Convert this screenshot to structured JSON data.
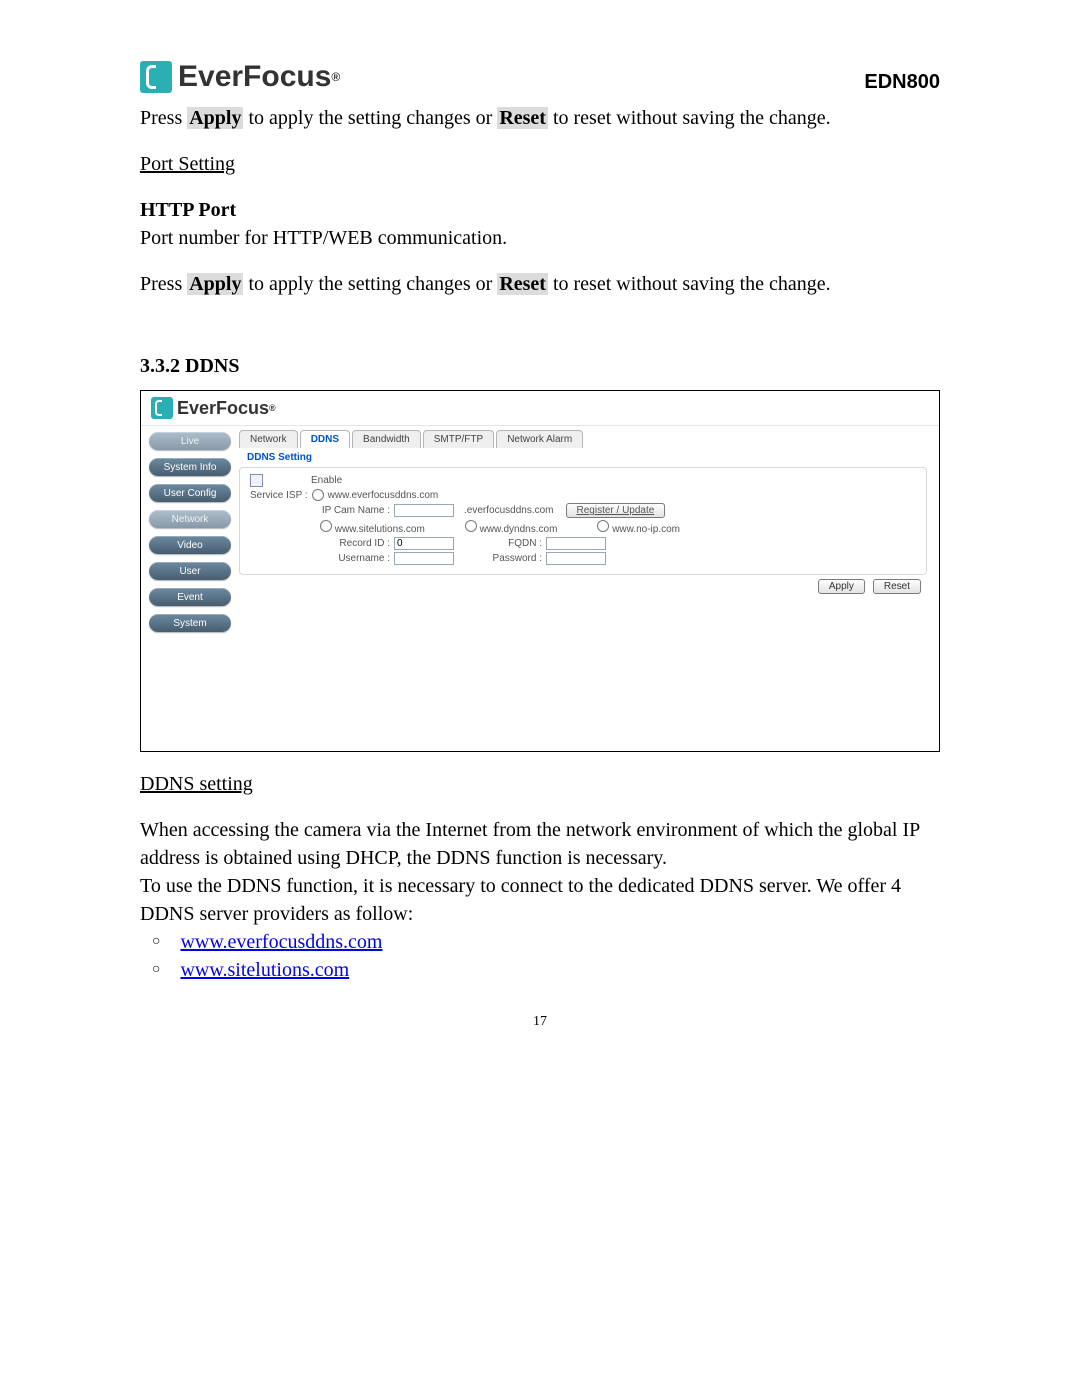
{
  "header": {
    "brand": "EverFocus",
    "model": "EDN800"
  },
  "p1_pre": "Press ",
  "p1_apply": "Apply",
  "p1_mid": " to apply the setting changes or ",
  "p1_reset": "Reset",
  "p1_post": " to reset without saving the change.",
  "port_setting_heading": "Port Setting",
  "http_port_heading": "HTTP Port",
  "http_port_desc": "Port number for HTTP/WEB communication.",
  "p2_pre": "Press ",
  "p2_apply": "Apply",
  "p2_mid": " to apply the setting changes or ",
  "p2_reset": "Reset",
  "p2_post": " to reset without saving the change.",
  "section_num_title": "3.3.2 DDNS",
  "shot": {
    "brand": "EverFocus",
    "sidebar": [
      "Live",
      "System Info",
      "User Config",
      "Network",
      "Video",
      "User",
      "Event",
      "System"
    ],
    "tabs": [
      "Network",
      "DDNS",
      "Bandwidth",
      "SMTP/FTP",
      "Network Alarm"
    ],
    "fieldset": "DDNS Setting",
    "enable_label": "Enable",
    "service_isp": "Service ISP :",
    "isp1": "www.everfocusddns.com",
    "ipcam_label": "IP Cam Name :",
    "suffix": ".everfocusddns.com",
    "register_btn": "Register / Update",
    "isp2": "www.sitelutions.com",
    "isp3": "www.dyndns.com",
    "isp4": "www.no-ip.com",
    "record_id": "Record ID :",
    "record_id_val": "0",
    "fqdn": "FQDN :",
    "username": "Username :",
    "password": "Password :",
    "apply": "Apply",
    "reset": "Reset"
  },
  "ddns_setting_heading": "DDNS setting",
  "ddns_para1": "When accessing the camera via the Internet from the network environment of which the global IP address is obtained using DHCP, the DDNS function is necessary.",
  "ddns_para2": "To use the DDNS function, it is necessary to connect to the dedicated DDNS server. We offer 4 DDNS server providers as follow:",
  "links": [
    "www.everfocusddns.com",
    "www.sitelutions.com"
  ],
  "page_number": "17",
  "bullet_marker": "○"
}
